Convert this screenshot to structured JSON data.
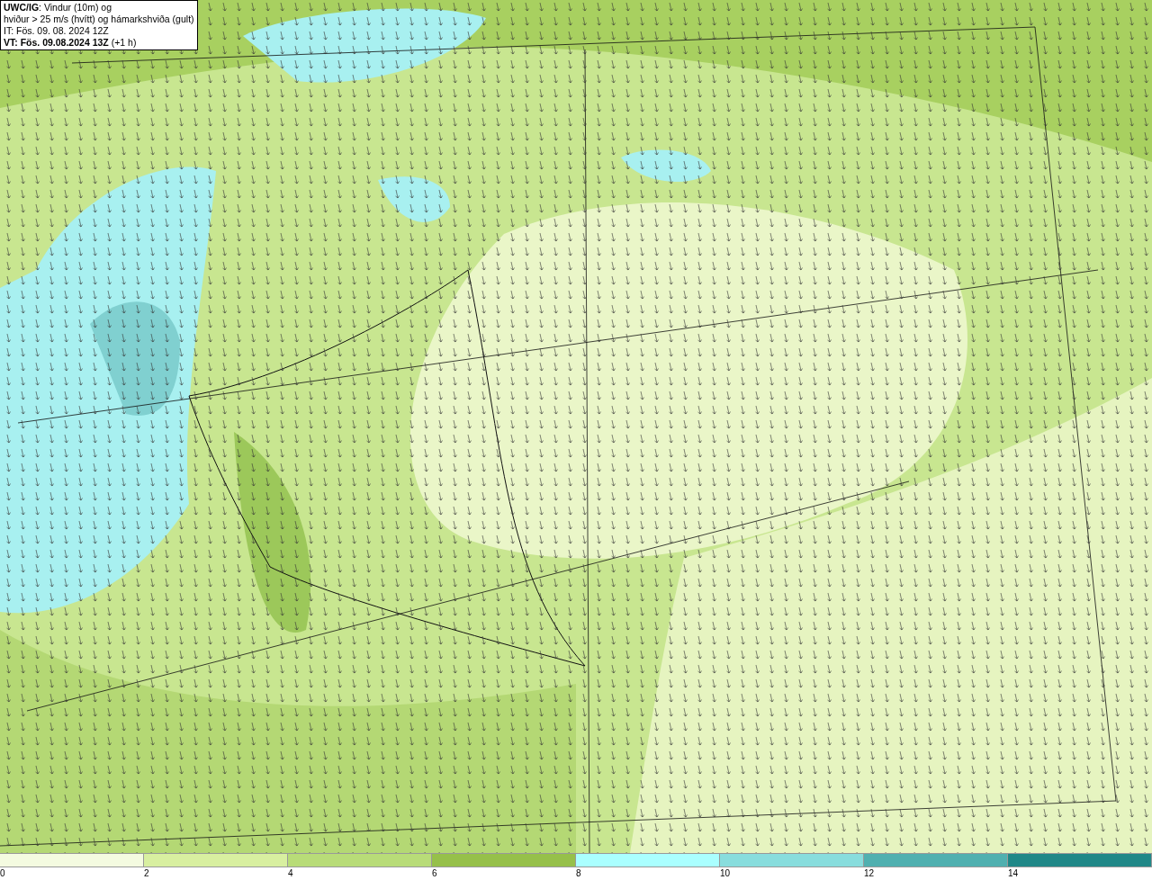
{
  "legend": {
    "lines": [
      "**UWC/IG**: Vindur (10m) og",
      "hviður > 25 m/s (hvítt) og hámarkshviða (gult)",
      "IT: Fös. 09. 08. 2024 12Z",
      "**VT: Fös. 09.08.2024 13Z** (+1 h)"
    ]
  },
  "colorbar": {
    "bins": [
      {
        "color": "#f4fbe0"
      },
      {
        "color": "#d8efa0"
      },
      {
        "color": "#b8dc78"
      },
      {
        "color": "#96c04a"
      },
      {
        "color": "#aaffff"
      },
      {
        "color": "#88dddd"
      },
      {
        "color": "#50b0b0"
      },
      {
        "color": "#208888"
      }
    ],
    "ticks": [
      "0",
      "2",
      "4",
      "6",
      "8",
      "10",
      "12",
      "14"
    ]
  }
}
